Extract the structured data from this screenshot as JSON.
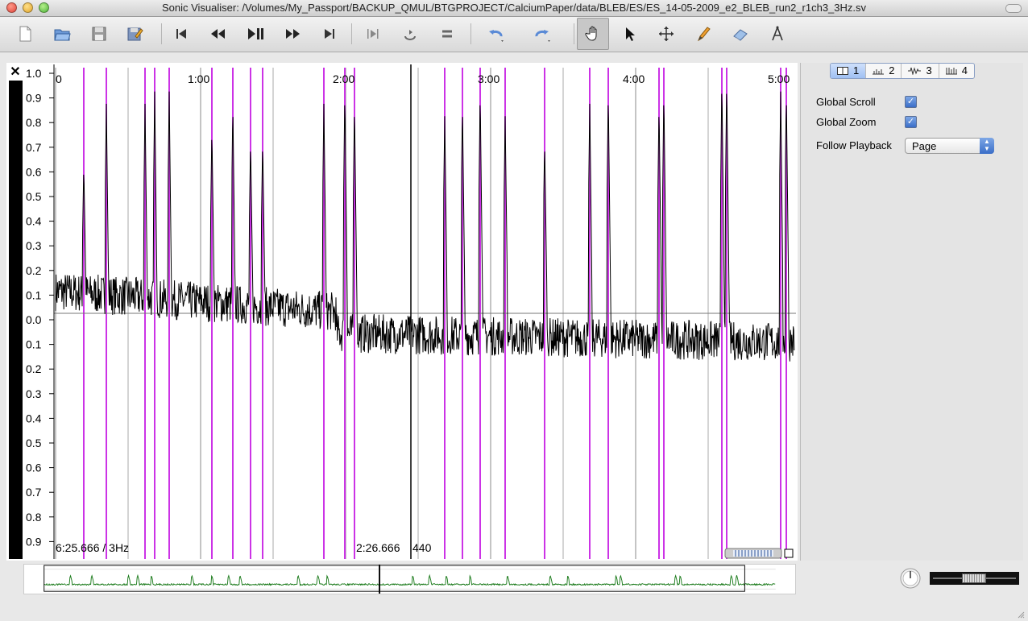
{
  "window": {
    "title": "Sonic Visualiser: /Volumes/My_Passport/BACKUP_QMUL/BTGPROJECT/CalciumPaper/data/BLEB/ES/ES_14-05-2009_e2_BLEB_run2_r1ch3_3Hz.sv"
  },
  "toolbar": {
    "buttons": [
      {
        "name": "new-session-button",
        "icon": "document-icon"
      },
      {
        "name": "open-button",
        "icon": "folder-open-icon"
      },
      {
        "name": "save-button",
        "icon": "floppy-icon"
      },
      {
        "name": "save-as-button",
        "icon": "floppy-pencil-icon"
      },
      {
        "name": "rewind-start-button",
        "icon": "skip-start-icon"
      },
      {
        "name": "rewind-button",
        "icon": "rewind-icon"
      },
      {
        "name": "play-pause-button",
        "icon": "play-pause-icon"
      },
      {
        "name": "fast-forward-button",
        "icon": "fast-forward-icon"
      },
      {
        "name": "ffwd-end-button",
        "icon": "skip-end-icon"
      },
      {
        "name": "play-selection-button",
        "icon": "play-selection-icon"
      },
      {
        "name": "loop-button",
        "icon": "loop-icon"
      },
      {
        "name": "solo-button",
        "icon": "solo-icon"
      },
      {
        "name": "undo-button",
        "icon": "undo-icon"
      },
      {
        "name": "redo-button",
        "icon": "redo-icon"
      },
      {
        "name": "navigate-tool-button",
        "icon": "hand-icon"
      },
      {
        "name": "select-tool-button",
        "icon": "arrow-cursor-icon"
      },
      {
        "name": "move-tool-button",
        "icon": "move-icon"
      },
      {
        "name": "draw-tool-button",
        "icon": "pencil-icon"
      },
      {
        "name": "erase-tool-button",
        "icon": "eraser-icon"
      },
      {
        "name": "measure-tool-button",
        "icon": "compass-icon"
      }
    ]
  },
  "pane": {
    "x_ticks": [
      "0",
      "1:00",
      "2:00",
      "3:00",
      "4:00",
      "5:00"
    ],
    "y_ticks": [
      "1.0",
      "0.9",
      "0.8",
      "0.7",
      "0.6",
      "0.5",
      "0.4",
      "0.3",
      "0.2",
      "0.1",
      "0.0",
      "0.1",
      "0.2",
      "0.3",
      "0.4",
      "0.5",
      "0.6",
      "0.7",
      "0.8",
      "0.9",
      "1.0"
    ],
    "status_left": "6:25.666 / 3Hz",
    "status_center": "2:26.666",
    "status_center_value": "440",
    "colors": {
      "waveform": "#000000",
      "markers": "#cc33e6",
      "gridlines": "#888888",
      "overview": "#1a7a1a"
    }
  },
  "property_box": {
    "tabs": [
      {
        "label": "1",
        "icon": "pane-icon"
      },
      {
        "label": "2",
        "icon": "ruler-icon"
      },
      {
        "label": "3",
        "icon": "waveform-icon"
      },
      {
        "label": "4",
        "icon": "instants-icon"
      }
    ],
    "global_scroll_label": "Global Scroll",
    "global_scroll_checked": true,
    "global_zoom_label": "Global Zoom",
    "global_zoom_checked": true,
    "follow_playback_label": "Follow Playback",
    "follow_playback_value": "Page"
  },
  "playback": {
    "speed_dial": "speed-dial-icon",
    "volume_fader": "volume-fader"
  }
}
